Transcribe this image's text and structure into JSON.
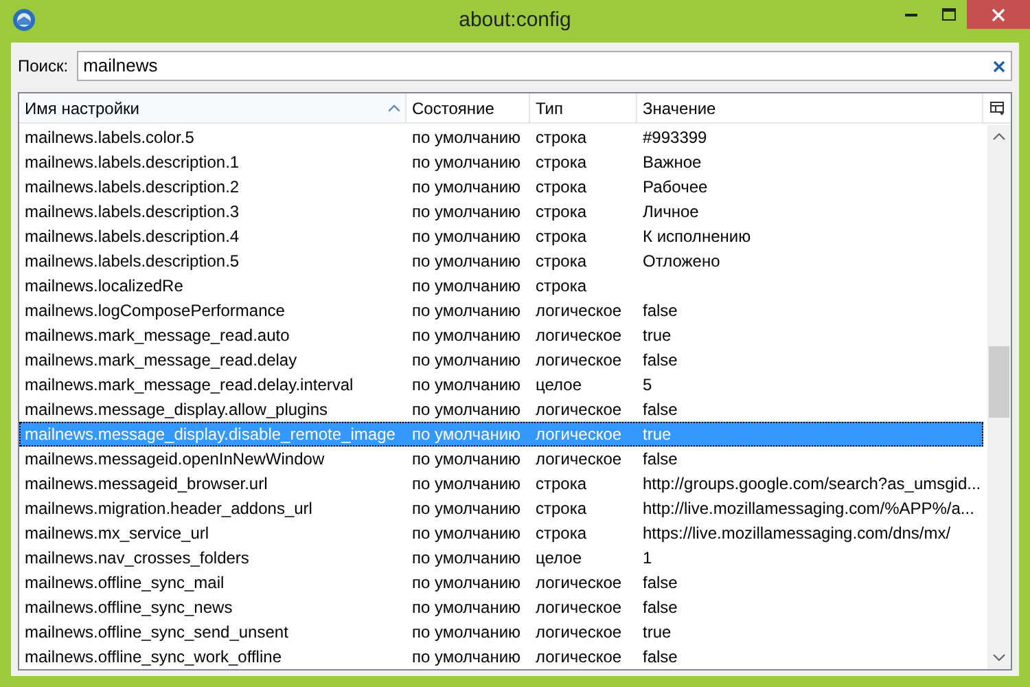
{
  "window": {
    "title": "about:config"
  },
  "search": {
    "label": "Поиск:",
    "value": "mailnews"
  },
  "table": {
    "columns": [
      {
        "label": "Имя настройки",
        "sorted": true
      },
      {
        "label": "Состояние",
        "sorted": false
      },
      {
        "label": "Тип",
        "sorted": false
      },
      {
        "label": "Значение",
        "sorted": false
      }
    ],
    "rows": [
      {
        "name": "mailnews.labels.color.5",
        "state": "по умолчанию",
        "type": "строка",
        "value": "#993399",
        "selected": false
      },
      {
        "name": "mailnews.labels.description.1",
        "state": "по умолчанию",
        "type": "строка",
        "value": "Важное",
        "selected": false
      },
      {
        "name": "mailnews.labels.description.2",
        "state": "по умолчанию",
        "type": "строка",
        "value": "Рабочее",
        "selected": false
      },
      {
        "name": "mailnews.labels.description.3",
        "state": "по умолчанию",
        "type": "строка",
        "value": "Личное",
        "selected": false
      },
      {
        "name": "mailnews.labels.description.4",
        "state": "по умолчанию",
        "type": "строка",
        "value": "К исполнению",
        "selected": false
      },
      {
        "name": "mailnews.labels.description.5",
        "state": "по умолчанию",
        "type": "строка",
        "value": "Отложено",
        "selected": false
      },
      {
        "name": "mailnews.localizedRe",
        "state": "по умолчанию",
        "type": "строка",
        "selected": false
      },
      {
        "name": "mailnews.logComposePerformance",
        "state": "по умолчанию",
        "type": "логическое",
        "value": "false",
        "selected": false
      },
      {
        "name": "mailnews.mark_message_read.auto",
        "state": "по умолчанию",
        "type": "логическое",
        "value": "true",
        "selected": false
      },
      {
        "name": "mailnews.mark_message_read.delay",
        "state": "по умолчанию",
        "type": "логическое",
        "value": "false",
        "selected": false
      },
      {
        "name": "mailnews.mark_message_read.delay.interval",
        "state": "по умолчанию",
        "type": "целое",
        "value": "5",
        "selected": false
      },
      {
        "name": "mailnews.message_display.allow_plugins",
        "state": "по умолчанию",
        "type": "логическое",
        "value": "false",
        "selected": false
      },
      {
        "name": "mailnews.message_display.disable_remote_image",
        "state": "по умолчанию",
        "type": "логическое",
        "value": "true",
        "selected": true
      },
      {
        "name": "mailnews.messageid.openInNewWindow",
        "state": "по умолчанию",
        "type": "логическое",
        "value": "false",
        "selected": false
      },
      {
        "name": "mailnews.messageid_browser.url",
        "state": "по умолчанию",
        "type": "строка",
        "value": "http://groups.google.com/search?as_umsgid...",
        "selected": false
      },
      {
        "name": "mailnews.migration.header_addons_url",
        "state": "по умолчанию",
        "type": "строка",
        "value": "http://live.mozillamessaging.com/%APP%/a...",
        "selected": false
      },
      {
        "name": "mailnews.mx_service_url",
        "state": "по умолчанию",
        "type": "строка",
        "value": "https://live.mozillamessaging.com/dns/mx/",
        "selected": false
      },
      {
        "name": "mailnews.nav_crosses_folders",
        "state": "по умолчанию",
        "type": "целое",
        "value": "1",
        "selected": false
      },
      {
        "name": "mailnews.offline_sync_mail",
        "state": "по умолчанию",
        "type": "логическое",
        "value": "false",
        "selected": false
      },
      {
        "name": "mailnews.offline_sync_news",
        "state": "по умолчанию",
        "type": "логическое",
        "value": "false",
        "selected": false
      },
      {
        "name": "mailnews.offline_sync_send_unsent",
        "state": "по умолчанию",
        "type": "логическое",
        "value": "true",
        "selected": false
      },
      {
        "name": "mailnews.offline_sync_work_offline",
        "state": "по умолчанию",
        "type": "логическое",
        "value": "false",
        "selected": false
      }
    ]
  }
}
